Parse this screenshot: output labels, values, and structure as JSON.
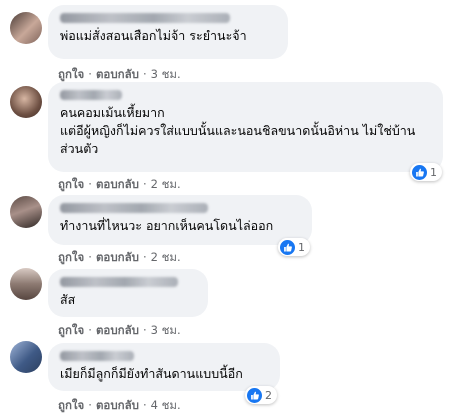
{
  "comments": [
    {
      "text": "พ่อแม่สั่งสอนเสือกไม่จ้า ระยำนะจ้า",
      "like_label": "ถูกใจ",
      "reply_label": "ตอบกลับ",
      "time": "3 ชม.",
      "reactions": null,
      "avatar_colors": [
        "#4a3b36",
        "#c8a899",
        "#7d6259"
      ]
    },
    {
      "text": "คนคอมเม้นเหี้ยมาก\nแต่อีผู้หญิงก็ไม่ควรใส่แบบนั้นและนอนชิลขนาดนั้นอิห่าน ไม่ใช่บ้านส่วนตัว",
      "like_label": "ถูกใจ",
      "reply_label": "ตอบกลับ",
      "time": "2 ชม.",
      "reactions": "1",
      "avatar_colors": [
        "#6e5043",
        "#d7b6a3",
        "#3d2a24"
      ]
    },
    {
      "text": "ทำงานที่ไหนวะ อยากเห็นคนโดนไล่ออก",
      "like_label": "ถูกใจ",
      "reply_label": "ตอบกลับ",
      "time": "2 ชม.",
      "reactions": "1",
      "avatar_colors": [
        "#5b4a44",
        "#a89089",
        "#2e2623"
      ]
    },
    {
      "text": "สัส",
      "like_label": "ถูกใจ",
      "reply_label": "ตอบกลับ",
      "time": "3 ชม.",
      "reactions": null,
      "avatar_colors": [
        "#8d7a72",
        "#d9cbc4",
        "#574640"
      ]
    },
    {
      "text": "เมียก็มีลูกก็มียังทำสันดานแบบนี้อีก",
      "like_label": "ถูกใจ",
      "reply_label": "ตอบกลับ",
      "time": "4 ชม.",
      "reactions": "2",
      "avatar_colors": [
        "#3f5a86",
        "#9fb4d8",
        "#2b3e5f"
      ]
    }
  ],
  "separator": "·",
  "colors": {
    "bubble": "#f0f2f5",
    "like_blue": "#1877f2",
    "meta": "#65676b"
  }
}
